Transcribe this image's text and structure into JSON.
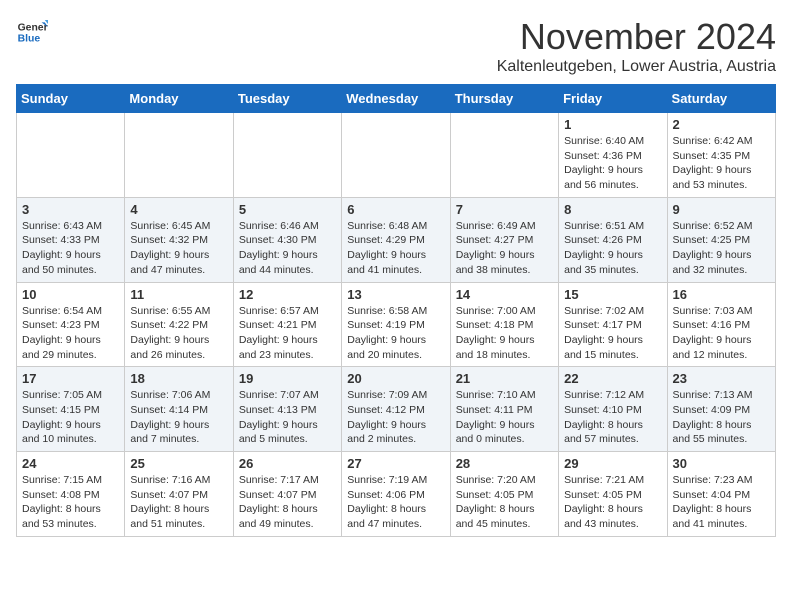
{
  "logo": {
    "general": "General",
    "blue": "Blue"
  },
  "title": "November 2024",
  "location": "Kaltenleutgeben, Lower Austria, Austria",
  "days_of_week": [
    "Sunday",
    "Monday",
    "Tuesday",
    "Wednesday",
    "Thursday",
    "Friday",
    "Saturday"
  ],
  "weeks": [
    [
      {
        "day": "",
        "info": ""
      },
      {
        "day": "",
        "info": ""
      },
      {
        "day": "",
        "info": ""
      },
      {
        "day": "",
        "info": ""
      },
      {
        "day": "",
        "info": ""
      },
      {
        "day": "1",
        "info": "Sunrise: 6:40 AM\nSunset: 4:36 PM\nDaylight: 9 hours and 56 minutes."
      },
      {
        "day": "2",
        "info": "Sunrise: 6:42 AM\nSunset: 4:35 PM\nDaylight: 9 hours and 53 minutes."
      }
    ],
    [
      {
        "day": "3",
        "info": "Sunrise: 6:43 AM\nSunset: 4:33 PM\nDaylight: 9 hours and 50 minutes."
      },
      {
        "day": "4",
        "info": "Sunrise: 6:45 AM\nSunset: 4:32 PM\nDaylight: 9 hours and 47 minutes."
      },
      {
        "day": "5",
        "info": "Sunrise: 6:46 AM\nSunset: 4:30 PM\nDaylight: 9 hours and 44 minutes."
      },
      {
        "day": "6",
        "info": "Sunrise: 6:48 AM\nSunset: 4:29 PM\nDaylight: 9 hours and 41 minutes."
      },
      {
        "day": "7",
        "info": "Sunrise: 6:49 AM\nSunset: 4:27 PM\nDaylight: 9 hours and 38 minutes."
      },
      {
        "day": "8",
        "info": "Sunrise: 6:51 AM\nSunset: 4:26 PM\nDaylight: 9 hours and 35 minutes."
      },
      {
        "day": "9",
        "info": "Sunrise: 6:52 AM\nSunset: 4:25 PM\nDaylight: 9 hours and 32 minutes."
      }
    ],
    [
      {
        "day": "10",
        "info": "Sunrise: 6:54 AM\nSunset: 4:23 PM\nDaylight: 9 hours and 29 minutes."
      },
      {
        "day": "11",
        "info": "Sunrise: 6:55 AM\nSunset: 4:22 PM\nDaylight: 9 hours and 26 minutes."
      },
      {
        "day": "12",
        "info": "Sunrise: 6:57 AM\nSunset: 4:21 PM\nDaylight: 9 hours and 23 minutes."
      },
      {
        "day": "13",
        "info": "Sunrise: 6:58 AM\nSunset: 4:19 PM\nDaylight: 9 hours and 20 minutes."
      },
      {
        "day": "14",
        "info": "Sunrise: 7:00 AM\nSunset: 4:18 PM\nDaylight: 9 hours and 18 minutes."
      },
      {
        "day": "15",
        "info": "Sunrise: 7:02 AM\nSunset: 4:17 PM\nDaylight: 9 hours and 15 minutes."
      },
      {
        "day": "16",
        "info": "Sunrise: 7:03 AM\nSunset: 4:16 PM\nDaylight: 9 hours and 12 minutes."
      }
    ],
    [
      {
        "day": "17",
        "info": "Sunrise: 7:05 AM\nSunset: 4:15 PM\nDaylight: 9 hours and 10 minutes."
      },
      {
        "day": "18",
        "info": "Sunrise: 7:06 AM\nSunset: 4:14 PM\nDaylight: 9 hours and 7 minutes."
      },
      {
        "day": "19",
        "info": "Sunrise: 7:07 AM\nSunset: 4:13 PM\nDaylight: 9 hours and 5 minutes."
      },
      {
        "day": "20",
        "info": "Sunrise: 7:09 AM\nSunset: 4:12 PM\nDaylight: 9 hours and 2 minutes."
      },
      {
        "day": "21",
        "info": "Sunrise: 7:10 AM\nSunset: 4:11 PM\nDaylight: 9 hours and 0 minutes."
      },
      {
        "day": "22",
        "info": "Sunrise: 7:12 AM\nSunset: 4:10 PM\nDaylight: 8 hours and 57 minutes."
      },
      {
        "day": "23",
        "info": "Sunrise: 7:13 AM\nSunset: 4:09 PM\nDaylight: 8 hours and 55 minutes."
      }
    ],
    [
      {
        "day": "24",
        "info": "Sunrise: 7:15 AM\nSunset: 4:08 PM\nDaylight: 8 hours and 53 minutes."
      },
      {
        "day": "25",
        "info": "Sunrise: 7:16 AM\nSunset: 4:07 PM\nDaylight: 8 hours and 51 minutes."
      },
      {
        "day": "26",
        "info": "Sunrise: 7:17 AM\nSunset: 4:07 PM\nDaylight: 8 hours and 49 minutes."
      },
      {
        "day": "27",
        "info": "Sunrise: 7:19 AM\nSunset: 4:06 PM\nDaylight: 8 hours and 47 minutes."
      },
      {
        "day": "28",
        "info": "Sunrise: 7:20 AM\nSunset: 4:05 PM\nDaylight: 8 hours and 45 minutes."
      },
      {
        "day": "29",
        "info": "Sunrise: 7:21 AM\nSunset: 4:05 PM\nDaylight: 8 hours and 43 minutes."
      },
      {
        "day": "30",
        "info": "Sunrise: 7:23 AM\nSunset: 4:04 PM\nDaylight: 8 hours and 41 minutes."
      }
    ]
  ]
}
